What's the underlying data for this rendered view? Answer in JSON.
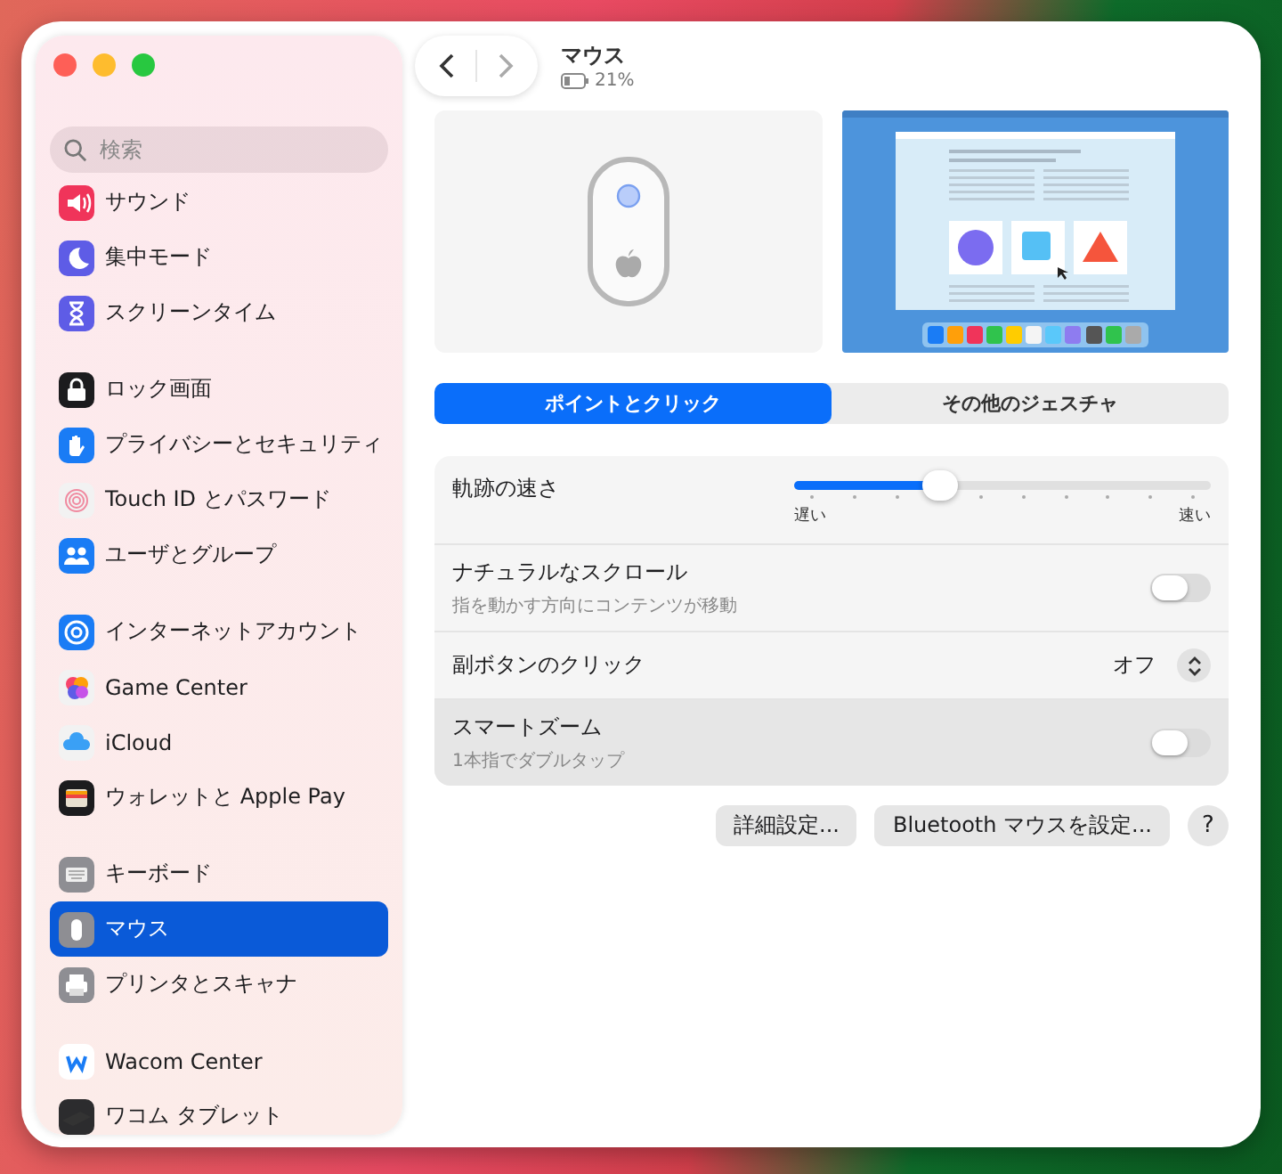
{
  "window": {
    "title": "マウス",
    "battery": "21%"
  },
  "search": {
    "placeholder": "検索"
  },
  "sidebar": {
    "groups": [
      {
        "items": [
          {
            "label": "サウンド",
            "color": "#f0345a",
            "selected": false
          },
          {
            "label": "集中モード",
            "color": "#5e5ce6",
            "selected": false
          },
          {
            "label": "スクリーンタイム",
            "color": "#5e5ce6",
            "selected": false
          }
        ]
      },
      {
        "items": [
          {
            "label": "ロック画面",
            "color": "#1c1c1e",
            "selected": false
          },
          {
            "label": "プライバシーとセキュリティ",
            "color": "#1a7cf5",
            "selected": false
          },
          {
            "label": "Touch ID とパスワード",
            "color": "#f2f2f2",
            "selected": false
          },
          {
            "label": "ユーザとグループ",
            "color": "#1a7cf5",
            "selected": false
          }
        ]
      },
      {
        "items": [
          {
            "label": "インターネットアカウント",
            "color": "#1a7cf5",
            "selected": false
          },
          {
            "label": "Game Center",
            "color": "#f2f2f2",
            "selected": false
          },
          {
            "label": "iCloud",
            "color": "#f2f2f2",
            "selected": false
          },
          {
            "label": "ウォレットと Apple Pay",
            "color": "#1c1c1e",
            "selected": false
          }
        ]
      },
      {
        "items": [
          {
            "label": "キーボード",
            "color": "#8e8e93",
            "selected": false
          },
          {
            "label": "マウス",
            "color": "#8e8e93",
            "selected": true
          },
          {
            "label": "プリンタとスキャナ",
            "color": "#8e8e93",
            "selected": false
          }
        ]
      },
      {
        "items": [
          {
            "label": "Wacom Center",
            "color": "#ffffff",
            "selected": false
          },
          {
            "label": "ワコム タブレット",
            "color": "#2c2c2e",
            "selected": false
          }
        ]
      }
    ]
  },
  "tabs": [
    {
      "label": "ポイントとクリック",
      "selected": true
    },
    {
      "label": "その他のジェスチャ",
      "selected": false
    }
  ],
  "settings": [
    {
      "kind": "slider",
      "label": "軌跡の速さ",
      "level": 0.35,
      "min_label": "遅い",
      "max_label": "速い"
    },
    {
      "kind": "toggle",
      "label": "ナチュラルなスクロール",
      "description": "指を動かす方向にコンテンツが移動",
      "on": false,
      "highlighted": false
    },
    {
      "kind": "popup",
      "label": "副ボタンのクリック",
      "value": "オフ"
    },
    {
      "kind": "toggle",
      "label": "スマートズーム",
      "description": "1本指でダブルタップ",
      "on": false,
      "highlighted": true
    }
  ],
  "buttons": [
    {
      "label": "詳細設定..."
    },
    {
      "label": "Bluetooth マウスを設定..."
    },
    {
      "label": "?"
    }
  ]
}
